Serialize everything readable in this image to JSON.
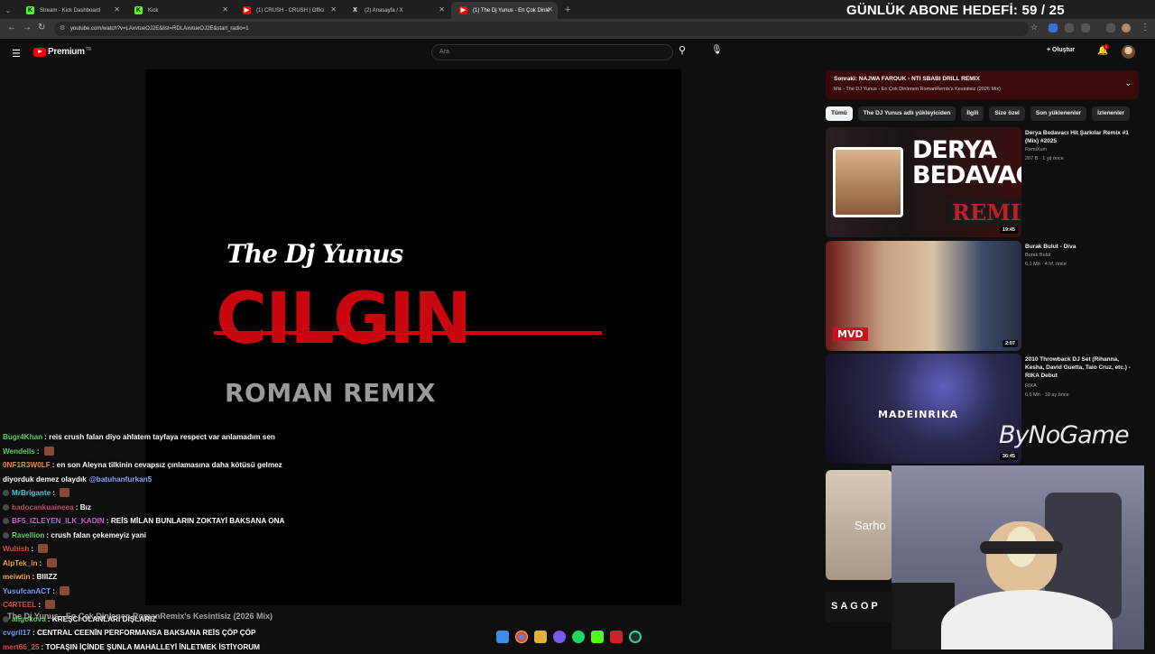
{
  "browser": {
    "tabs": [
      {
        "title": "Stream - Kick Dashboard",
        "icon": "kick-icon",
        "color": "#53fc18",
        "active": false
      },
      {
        "title": "Kick",
        "icon": "kick-icon",
        "color": "#53fc18",
        "active": false
      },
      {
        "title": "(1) CRUSH - CRUSH | Offici",
        "icon": "youtube-icon",
        "color": "#ff0000",
        "active": false
      },
      {
        "title": "(2) Anasayfa / X",
        "icon": "x-icon",
        "color": "#ffffff",
        "active": false
      },
      {
        "title": "(1) The Dj Yunus - En Çok Dinle",
        "icon": "youtube-icon",
        "color": "#ff0000",
        "active": true
      }
    ],
    "url": "youtube.com/watch?v=LAxvtueOJ2E&list=RDLAxvtueOJ2E&start_radio=1"
  },
  "overlay": {
    "sub_goal": "GÜNLÜK ABONE HEDEFİ: 59 / 25",
    "brand": "ByNoGame"
  },
  "youtube": {
    "logo_text": "Premium",
    "logo_suffix": "TR",
    "search_placeholder": "Ara",
    "create_label": "+ Oluştur",
    "notification_count": "1"
  },
  "video": {
    "artist_line": "The Dj Yunus",
    "main_word": "CILGIN",
    "sub_line": "ROMAN REMIX"
  },
  "queue": {
    "next_label": "Sonraki:",
    "next_title": "NAJWA FAROUK - NTI SBABI DRILL REMIX",
    "playlist": "Mix - The DJ Yunus - En Çok Dinlenen RomanRemix's Kesintisiz (2026 Mix)"
  },
  "chips": [
    "Tümü",
    "The DJ Yunus adlı yükleyiciden",
    "İlgili",
    "Size özel",
    "Son yüklenenler",
    "İzlenenler"
  ],
  "recommendations": [
    {
      "title": "Derya Bedavacı Hit Şarkılar Remix #1 (Mix) #2025",
      "channel": "RemiXum",
      "meta": "207 B · 1 yıl önce",
      "duration": "19:45",
      "thumb_text": "DERYA BEDAVACI REMIX"
    },
    {
      "title": "Burak Bulut - Diva",
      "channel": "Burak Bulut",
      "meta": "6,1 Mn · 4 hf. önce",
      "duration": "2:07",
      "thumb_text": "MVD MEDIA"
    },
    {
      "title": "2010 Throwback DJ Set (Rihanna, Kesha, David Guetta, Taio Cruz, etc.) - RIKA Debut",
      "channel": "RIKA",
      "meta": "6,6 Mn · 10 ay önce",
      "duration": "36:45",
      "thumb_text": "MADEINRIKA"
    },
    {
      "title": "",
      "channel": "",
      "meta": "",
      "duration": "",
      "thumb_text": "Sarho"
    }
  ],
  "chat": [
    {
      "user": "Bugr4Khan",
      "color": "#5ad45a",
      "text": "reis crush falan diyo ahlatem tayfaya respect var anlamadım sen"
    },
    {
      "user": "Wendells",
      "color": "#5ad45a",
      "text": "",
      "emote": true
    },
    {
      "user": "0NF1R3W0LF",
      "color": "#f08a3c",
      "text": "en son Aleyna tilkinin cevapsız çınlamasına daha kötüsü gelmez"
    },
    {
      "user": "",
      "color": "#ffffff",
      "text": "diyorduk demez olaydık",
      "mention": "@batuhanfurkan5"
    },
    {
      "user": "MrBrigante",
      "color": "#4ad0d0",
      "text": "",
      "emote": true,
      "badge": true
    },
    {
      "user": "badocankuaineea",
      "color": "#c24a6a",
      "text": "Bız",
      "badge": true
    },
    {
      "user": "BF5_IZLEYEN_ILK_KADIN",
      "color": "#d05ad0",
      "text": "REİS MİLAN BUNLARIN ZOKTAYİ BAKSANA ONA",
      "badge": true
    },
    {
      "user": "Ravellion",
      "color": "#5ad45a",
      "text": "crush falan çekemeyiz yani",
      "badge": true
    },
    {
      "user": "Wubish",
      "color": "#e04a4a",
      "text": "",
      "emote": true
    },
    {
      "user": "AlpTek_in",
      "color": "#f0a040",
      "text": "",
      "emote": true
    },
    {
      "user": "meiwtin",
      "color": "#f0a040",
      "text": "BIIIZZ"
    },
    {
      "user": "YusufcanACT",
      "color": "#6aa0ff",
      "text": "",
      "emote": true
    },
    {
      "user": "C4RTEEL",
      "color": "#e04a4a",
      "text": "",
      "emote": true
    },
    {
      "user": "aligokova",
      "color": "#5ad45a",
      "text": "KREŞCİ OLANLARI DIŞLARIZ",
      "badge": true
    },
    {
      "user": "cvgril17",
      "color": "#6aa0ff",
      "text": "CENTRAL CEENİN PERFORMANSA BAKSANA REİS ÇÖP ÇÖP"
    },
    {
      "user": "mert66_25",
      "color": "#e04a4a",
      "text": "TOFAŞIN İÇİNDE ŞUNLA MAHALLEYİ İNLETMEK İSTİYORUM"
    }
  ],
  "ticker": "The Dj Yunus - En Çok Dinlenen RomanRemix's Kesintisiz (2026 Mix)",
  "webcam": {
    "sign_text": "SAGOP"
  }
}
